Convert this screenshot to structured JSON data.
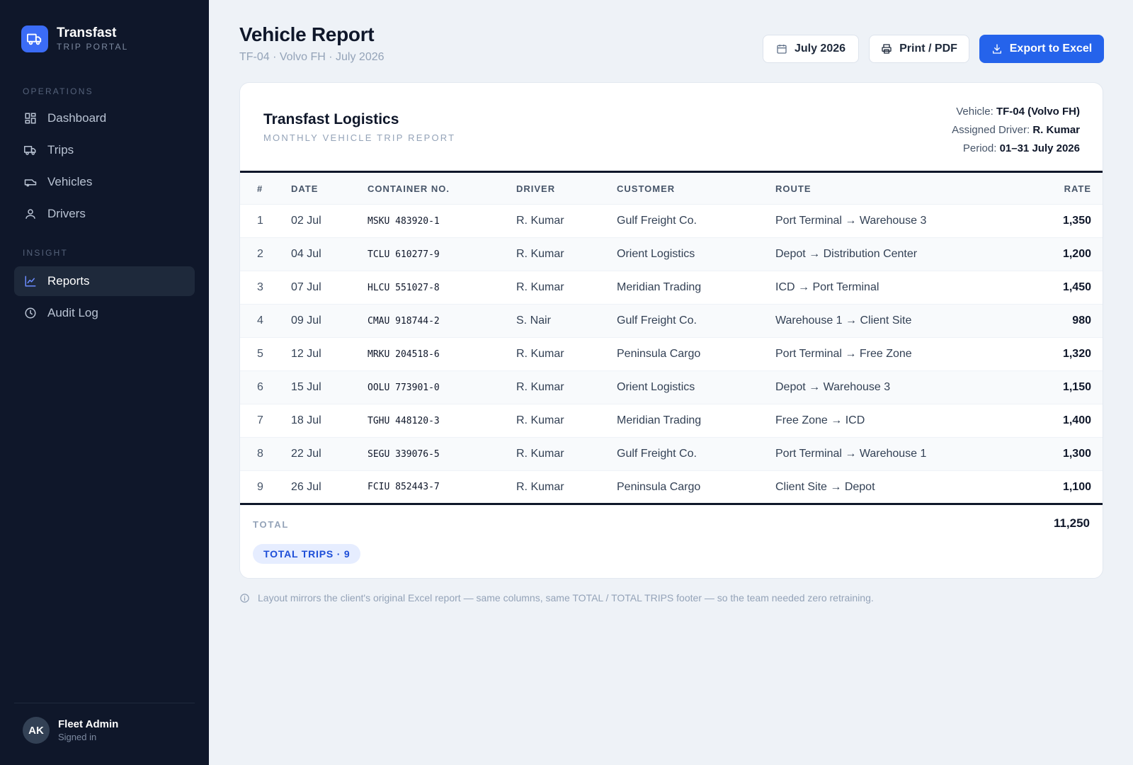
{
  "app": {
    "name": "Transfast",
    "subtitle": "TRIP PORTAL"
  },
  "sidebar": {
    "sections": [
      {
        "label": "OPERATIONS",
        "items": [
          {
            "label": "Dashboard",
            "icon": "dashboard-icon"
          },
          {
            "label": "Trips",
            "icon": "truck-icon"
          },
          {
            "label": "Vehicles",
            "icon": "vehicle-icon"
          },
          {
            "label": "Drivers",
            "icon": "user-icon"
          }
        ]
      },
      {
        "label": "INSIGHT",
        "items": [
          {
            "label": "Reports",
            "icon": "chart-icon",
            "active": true
          },
          {
            "label": "Audit Log",
            "icon": "clock-icon"
          }
        ]
      }
    ],
    "user": {
      "initials": "AK",
      "name": "Fleet Admin",
      "status": "Signed in"
    }
  },
  "header": {
    "title": "Vehicle Report",
    "subtitle": "TF-04 · Volvo FH · July 2026",
    "period_button": "July 2026",
    "print_button": "Print / PDF",
    "export_button": "Export to Excel"
  },
  "report": {
    "company": "Transfast Logistics",
    "report_type": "MONTHLY VEHICLE TRIP REPORT",
    "vehicle_label": "Vehicle:",
    "vehicle_value": "TF-04 (Volvo FH)",
    "driver_label": "Assigned Driver:",
    "driver_value": "R. Kumar",
    "period_label": "Period:",
    "period_value": "01–31 July 2026",
    "columns": [
      "#",
      "DATE",
      "CONTAINER NO.",
      "DRIVER",
      "CUSTOMER",
      "ROUTE",
      "RATE"
    ],
    "rows": [
      [
        "1",
        "02 Jul",
        "MSKU 483920-1",
        "R. Kumar",
        "Gulf Freight Co.",
        "Port Terminal → Warehouse 3",
        "1,350"
      ],
      [
        "2",
        "04 Jul",
        "TCLU 610277-9",
        "R. Kumar",
        "Orient Logistics",
        "Depot → Distribution Center",
        "1,200"
      ],
      [
        "3",
        "07 Jul",
        "HLCU 551027-8",
        "R. Kumar",
        "Meridian Trading",
        "ICD → Port Terminal",
        "1,450"
      ],
      [
        "4",
        "09 Jul",
        "CMAU 918744-2",
        "S. Nair",
        "Gulf Freight Co.",
        "Warehouse 1 → Client Site",
        "980"
      ],
      [
        "5",
        "12 Jul",
        "MRKU 204518-6",
        "R. Kumar",
        "Peninsula Cargo",
        "Port Terminal → Free Zone",
        "1,320"
      ],
      [
        "6",
        "15 Jul",
        "OOLU 773901-0",
        "R. Kumar",
        "Orient Logistics",
        "Depot → Warehouse 3",
        "1,150"
      ],
      [
        "7",
        "18 Jul",
        "TGHU 448120-3",
        "R. Kumar",
        "Meridian Trading",
        "Free Zone → ICD",
        "1,400"
      ],
      [
        "8",
        "22 Jul",
        "SEGU 339076-5",
        "R. Kumar",
        "Gulf Freight Co.",
        "Port Terminal → Warehouse 1",
        "1,300"
      ],
      [
        "9",
        "26 Jul",
        "FCIU 852443-7",
        "R. Kumar",
        "Peninsula Cargo",
        "Client Site → Depot",
        "1,100"
      ]
    ],
    "total_label": "TOTAL",
    "total_value": "11,250",
    "trips_label": "TOTAL TRIPS · 9"
  },
  "note": "Layout mirrors the client's original Excel report — same columns, same TOTAL / TOTAL TRIPS footer — so the team needed zero retraining.",
  "colors": {
    "accent": "#2563eb",
    "sidebar": "#0f172a",
    "background": "#eef2f7"
  }
}
